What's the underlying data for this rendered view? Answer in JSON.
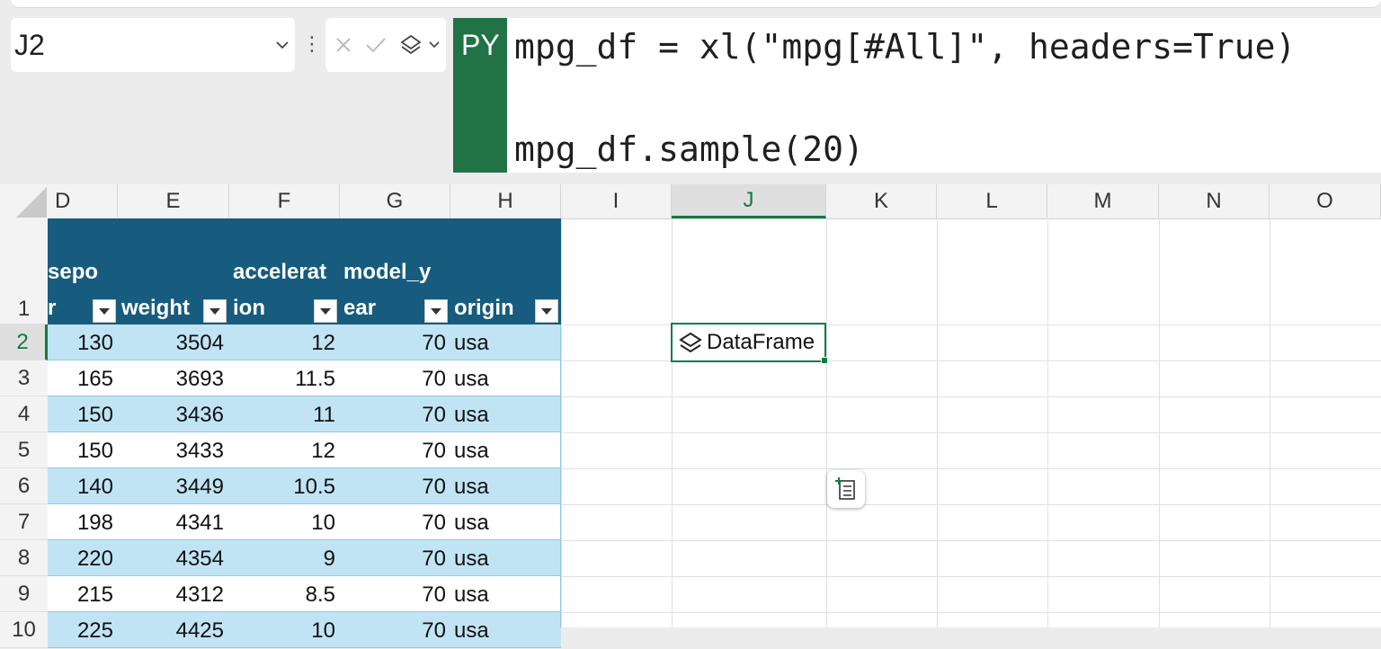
{
  "name_box": {
    "value": "J2"
  },
  "formula_bar": {
    "badge": "PY",
    "line1": "mpg_df = xl(\"mpg[#All]\", headers=True)",
    "line2": "mpg_df.sample(20)"
  },
  "columns": [
    "D",
    "E",
    "F",
    "G",
    "H",
    "I",
    "J",
    "K",
    "L",
    "M",
    "N",
    "O"
  ],
  "selected_column": "J",
  "rows": [
    "1",
    "2",
    "3",
    "4",
    "5",
    "6",
    "7",
    "8",
    "9",
    "10"
  ],
  "selected_row": "2",
  "table": {
    "headers": [
      {
        "line1": "sepo",
        "line2": "r"
      },
      {
        "line1": "",
        "line2": "weight"
      },
      {
        "line1": "accelerat",
        "line2": "ion"
      },
      {
        "line1": "model_y",
        "line2": "ear"
      },
      {
        "line1": "",
        "line2": "origin"
      }
    ],
    "data": [
      [
        "130",
        "3504",
        "12",
        "70",
        "usa"
      ],
      [
        "165",
        "3693",
        "11.5",
        "70",
        "usa"
      ],
      [
        "150",
        "3436",
        "11",
        "70",
        "usa"
      ],
      [
        "150",
        "3433",
        "12",
        "70",
        "usa"
      ],
      [
        "140",
        "3449",
        "10.5",
        "70",
        "usa"
      ],
      [
        "198",
        "4341",
        "10",
        "70",
        "usa"
      ],
      [
        "220",
        "4354",
        "9",
        "70",
        "usa"
      ],
      [
        "215",
        "4312",
        "8.5",
        "70",
        "usa"
      ],
      [
        "225",
        "4425",
        "10",
        "70",
        "usa"
      ]
    ]
  },
  "active_cell": {
    "text": "DataFrame",
    "icon": "python-object-icon"
  },
  "colors": {
    "table_header": "#175c7f",
    "band": "#c1e4f5",
    "python_badge": "#217346",
    "selection": "#107c41"
  }
}
